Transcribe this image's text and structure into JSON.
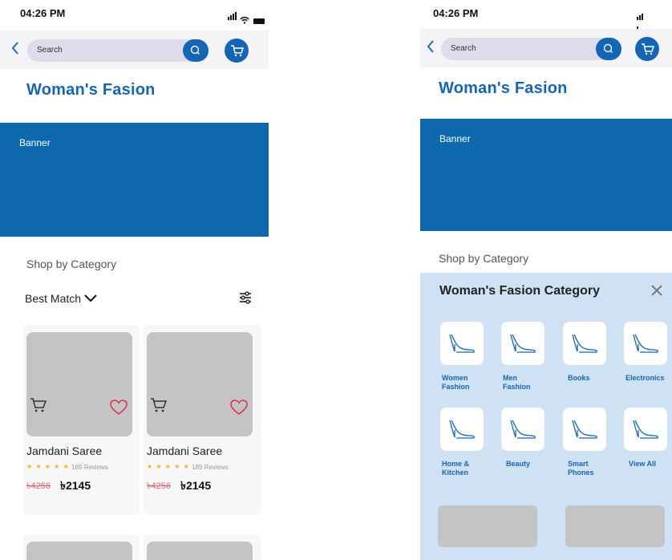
{
  "status": {
    "time": "04:26 PM"
  },
  "search": {
    "placeholder": "Search"
  },
  "page": {
    "title": "Woman's Fasion",
    "banner": "Banner",
    "shop_by_category": "Shop by Category"
  },
  "sort": {
    "label": "Best Match"
  },
  "products": [
    {
      "name": "Jamdani Saree",
      "rating_stars": "★ ★ ★ ★ ★",
      "reviews": "189 Reviews",
      "currency_old": "৳",
      "old_price": "4256",
      "new_price": "৳2145"
    },
    {
      "name": "Jamdani Saree",
      "rating_stars": "★ ★ ★ ★ ★",
      "reviews": "189 Reviews",
      "currency_old": "৳",
      "old_price": "4256",
      "new_price": "৳2145"
    }
  ],
  "category_panel": {
    "title": "Woman's Fasion Category",
    "items": [
      {
        "label": "Women\nFashion",
        "icon": "heel-icon"
      },
      {
        "label": "Men\nFashion",
        "icon": "heel-icon"
      },
      {
        "label": "Books",
        "icon": "heel-icon"
      },
      {
        "label": "Electronics",
        "icon": "heel-icon"
      },
      {
        "label": "Home &\nKitchen",
        "icon": "heel-icon"
      },
      {
        "label": "Beauty",
        "icon": "heel-icon"
      },
      {
        "label": "Smart\nPhones",
        "icon": "heel-icon"
      },
      {
        "label": "View All",
        "icon": "heel-icon"
      }
    ]
  },
  "colors": {
    "primary": "#1565b6",
    "banner": "#0d68ad",
    "panel": "#cfe2f3",
    "star": "#f2b01e",
    "heart": "#e0334f"
  }
}
